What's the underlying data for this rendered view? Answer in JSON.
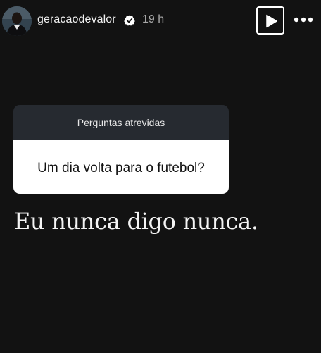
{
  "header": {
    "username": "geracaodevalor",
    "verified_icon": "verified-badge-icon",
    "time": "19 h",
    "play_icon": "play-icon",
    "more_icon": "more-horizontal-icon"
  },
  "question_sticker": {
    "title": "Perguntas atrevidas",
    "question": "Um dia volta para o futebol?"
  },
  "answer": {
    "text": "Eu nunca digo nunca."
  },
  "colors": {
    "background": "#121212",
    "sticker_header": "#262a30",
    "sticker_body": "#ffffff",
    "text_primary": "#f2f2f2",
    "text_secondary": "#a8a8a8"
  }
}
